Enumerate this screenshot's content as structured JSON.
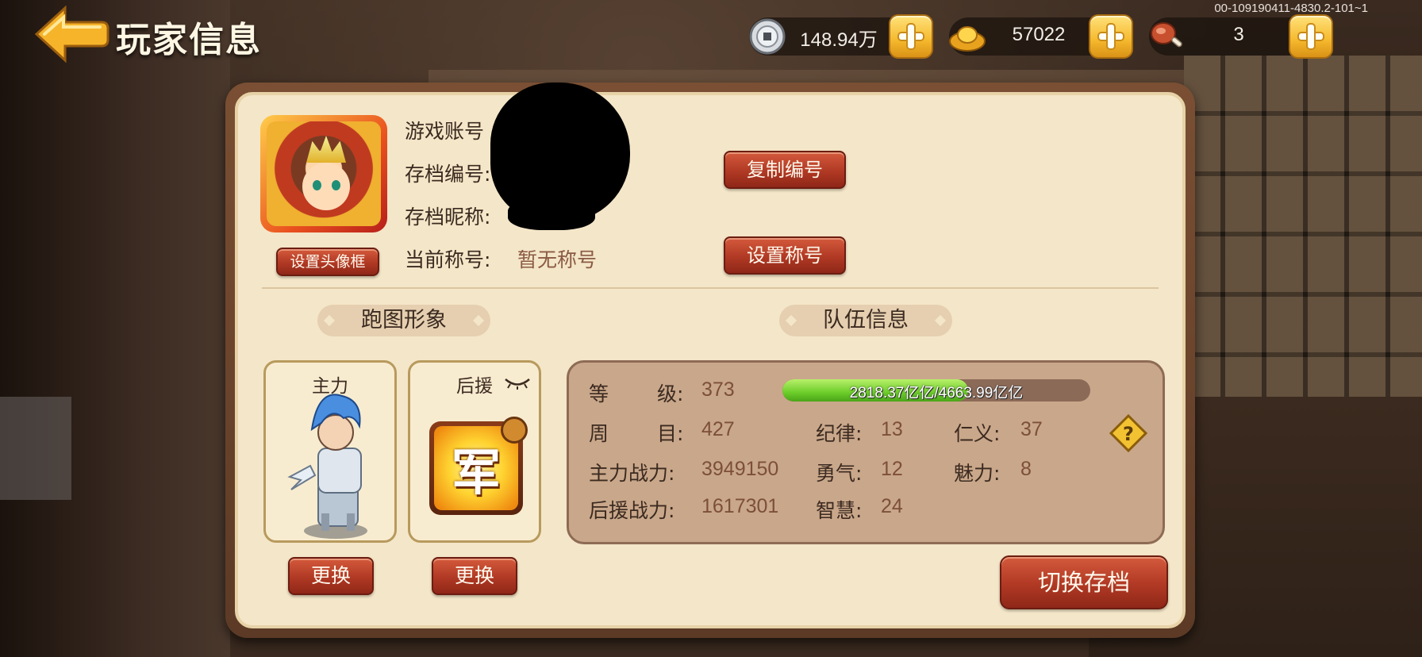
{
  "window": {
    "title": "玩家信息",
    "version": "00-109190411-4830.2-101~1"
  },
  "currencies": [
    {
      "icon": "silver-coin-icon",
      "value": "148.94万"
    },
    {
      "icon": "gold-ingot-icon",
      "value": "57022"
    },
    {
      "icon": "meat-icon",
      "value": "3"
    }
  ],
  "profile": {
    "labels": {
      "account": "游戏账号",
      "save_id": "存档编号:",
      "save_nick": "存档昵称:",
      "current_title": "当前称号:"
    },
    "current_title_value": "暂无称号",
    "buttons": {
      "set_frame": "设置头像框",
      "copy_id": "复制编号",
      "set_title": "设置称号"
    }
  },
  "sections": {
    "appearance": "跑图形象",
    "team": "队伍信息"
  },
  "cards": {
    "main_label": "主力",
    "support_label": "后援",
    "army_glyph": "军",
    "change_label": "更换"
  },
  "team": {
    "level_label_1": "等",
    "level_label_2": "级:",
    "level": "373",
    "exp_text": "2818.37亿亿/4663.99亿亿",
    "exp_progress": 0.604,
    "round_label_1": "周",
    "round_label_2": "目:",
    "round": "427",
    "main_power_label": "主力战力:",
    "main_power": "3949150",
    "support_power_label": "后援战力:",
    "support_power": "1617301",
    "discipline_label": "纪律:",
    "discipline": "13",
    "courage_label": "勇气:",
    "courage": "12",
    "wisdom_label": "智慧:",
    "wisdom": "24",
    "benevolence_label": "仁义:",
    "benevolence": "37",
    "charm_label": "魅力:",
    "charm": "8"
  },
  "switch_save_label": "切换存档",
  "colors": {
    "accent_red": "#b03924",
    "panel_bg": "#f4e6c8",
    "exp_green": "#6ccd2a"
  }
}
